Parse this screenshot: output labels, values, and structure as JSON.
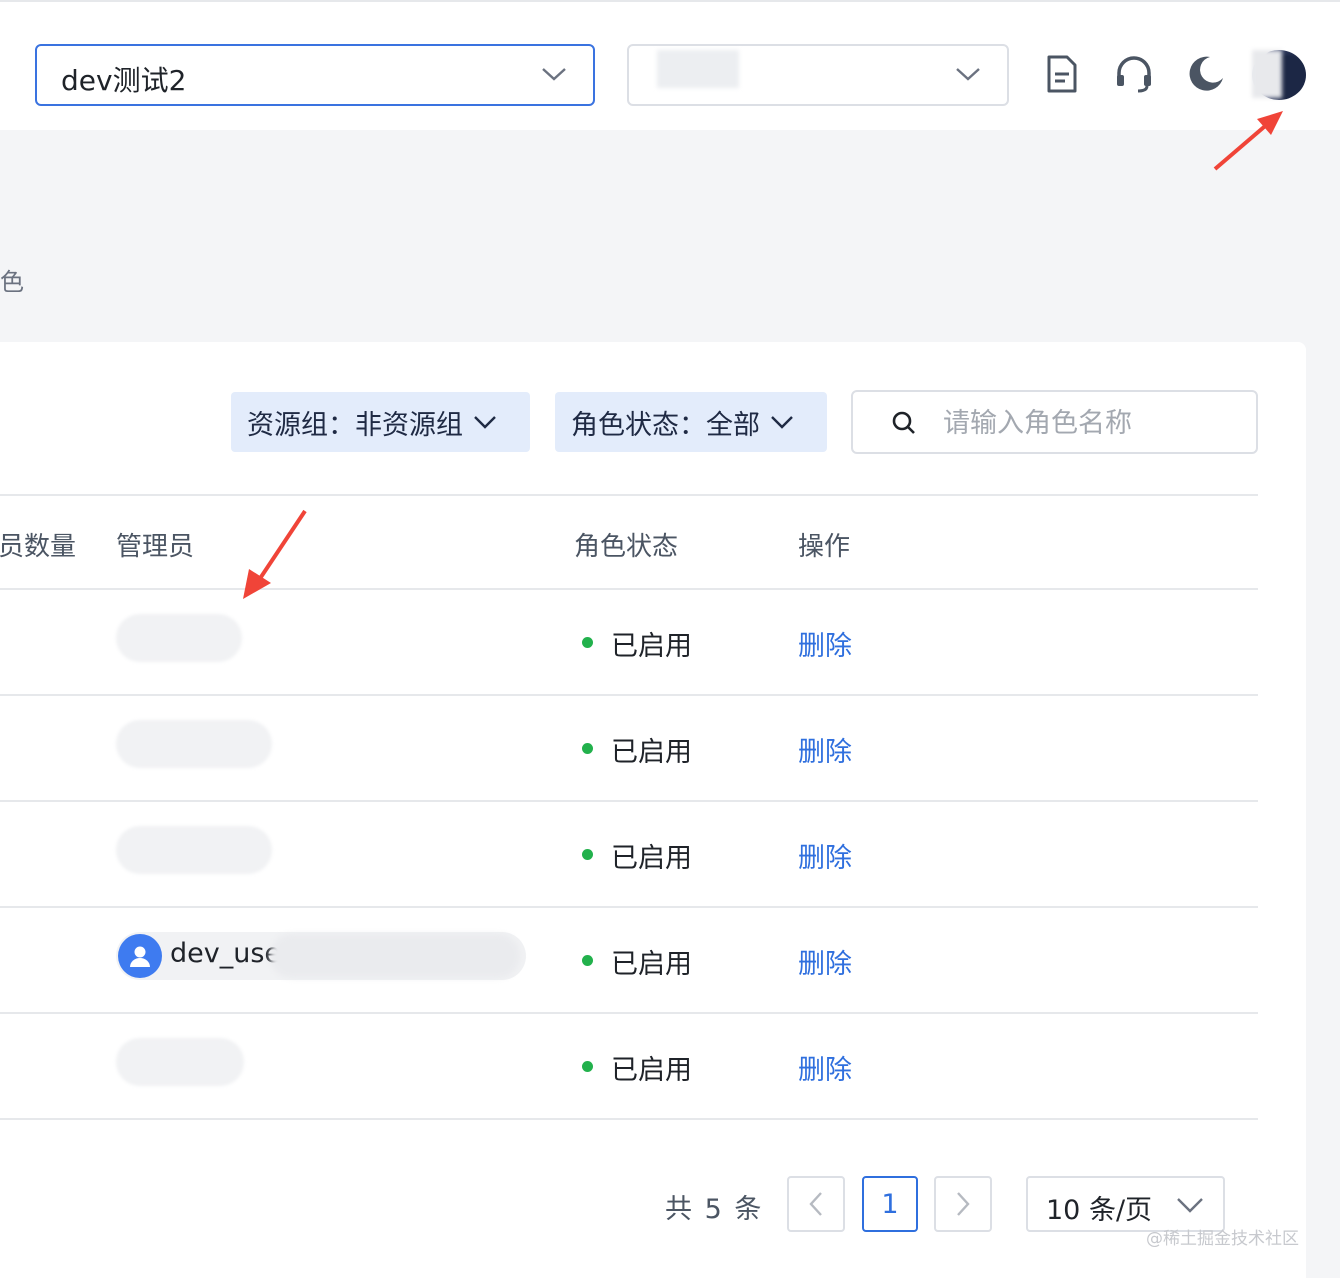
{
  "header": {
    "project_select_value": "dev测试2",
    "env_select_value": "",
    "icons": [
      "document-icon",
      "headset-icon",
      "moon-icon",
      "user-avatar"
    ]
  },
  "breadcrumb_fragment": "色",
  "filters": {
    "resource_group_label": "资源组：非资源组",
    "role_status_label": "角色状态：全部",
    "search_placeholder": "请输入角色名称"
  },
  "table": {
    "columns": [
      "员数量",
      "管理员",
      "角色状态",
      "操作"
    ],
    "rows": [
      {
        "admin": "",
        "status": "已启用",
        "action": "删除"
      },
      {
        "admin": "",
        "status": "已启用",
        "action": "删除"
      },
      {
        "admin": "",
        "status": "已启用",
        "action": "删除"
      },
      {
        "admin": "dev_use",
        "status": "已启用",
        "action": "删除"
      },
      {
        "admin": "",
        "status": "已启用",
        "action": "删除"
      }
    ]
  },
  "pagination": {
    "total_text": "共 5 条",
    "current_page": "1",
    "page_size_label": "10 条/页"
  },
  "watermark": "@稀土掘金技术社区",
  "colors": {
    "accent": "#2f6fde",
    "status_enabled": "#22b14c",
    "annotation_arrow": "#f04438"
  }
}
